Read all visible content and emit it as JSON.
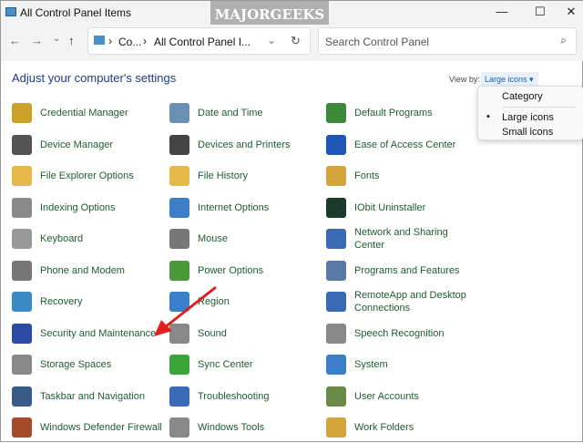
{
  "window": {
    "title": "All Control Panel Items",
    "minimize": "—",
    "maximize": "☐",
    "close": "✕"
  },
  "nav": {
    "back": "←",
    "forward": "→",
    "recent": "⌄",
    "up": "↑"
  },
  "address": {
    "crumb1": "Co...",
    "crumb2": "All Control Panel I...",
    "sep": "›",
    "dropdown": "⌄",
    "refresh": "↻"
  },
  "search": {
    "placeholder": "Search Control Panel",
    "icon": "⌕"
  },
  "heading": "Adjust your computer's settings",
  "view_by": {
    "label": "View by:",
    "value": "Large icons ▾",
    "options": [
      "Category",
      "Large icons",
      "Small icons"
    ],
    "selected_bullet": "•"
  },
  "watermark": "MAJORGEEKS .COM",
  "items": [
    {
      "label": "Credential Manager",
      "color": "#c9a227"
    },
    {
      "label": "Date and Time",
      "color": "#6a8fb5"
    },
    {
      "label": "Default Programs",
      "color": "#3a8a3a"
    },
    {
      "label": "Device Manager",
      "color": "#555"
    },
    {
      "label": "Devices and Printers",
      "color": "#444"
    },
    {
      "label": "Ease of Access Center",
      "color": "#1f56b5"
    },
    {
      "label": "File Explorer Options",
      "color": "#e6b84a"
    },
    {
      "label": "File History",
      "color": "#e6b84a"
    },
    {
      "label": "Fonts",
      "color": "#d4a53a"
    },
    {
      "label": "Indexing Options",
      "color": "#8a8a8a"
    },
    {
      "label": "Internet Options",
      "color": "#3a7fc8"
    },
    {
      "label": "IObit Uninstaller",
      "color": "#1a3a2a"
    },
    {
      "label": "Keyboard",
      "color": "#999"
    },
    {
      "label": "Mouse",
      "color": "#777"
    },
    {
      "label": "Network and Sharing Center",
      "color": "#3a6ab5"
    },
    {
      "label": "Phone and Modem",
      "color": "#777"
    },
    {
      "label": "Power Options",
      "color": "#4a9a3a"
    },
    {
      "label": "Programs and Features",
      "color": "#5a7aa5"
    },
    {
      "label": "Recovery",
      "color": "#3a8ac8"
    },
    {
      "label": "Region",
      "color": "#3a7fc8"
    },
    {
      "label": "RemoteApp and Desktop Connections",
      "color": "#3a6ab5"
    },
    {
      "label": "Security and Maintenance",
      "color": "#2a4aa5"
    },
    {
      "label": "Sound",
      "color": "#888"
    },
    {
      "label": "Speech Recognition",
      "color": "#888"
    },
    {
      "label": "Storage Spaces",
      "color": "#888"
    },
    {
      "label": "Sync Center",
      "color": "#3aa53a"
    },
    {
      "label": "System",
      "color": "#3a7fc8"
    },
    {
      "label": "Taskbar and Navigation",
      "color": "#3a5a8a"
    },
    {
      "label": "Troubleshooting",
      "color": "#3a6ab5"
    },
    {
      "label": "User Accounts",
      "color": "#6a8a4a"
    },
    {
      "label": "Windows Defender Firewall",
      "color": "#a54a2a"
    },
    {
      "label": "Windows Tools",
      "color": "#888"
    },
    {
      "label": "Work Folders",
      "color": "#d4a53a"
    }
  ]
}
